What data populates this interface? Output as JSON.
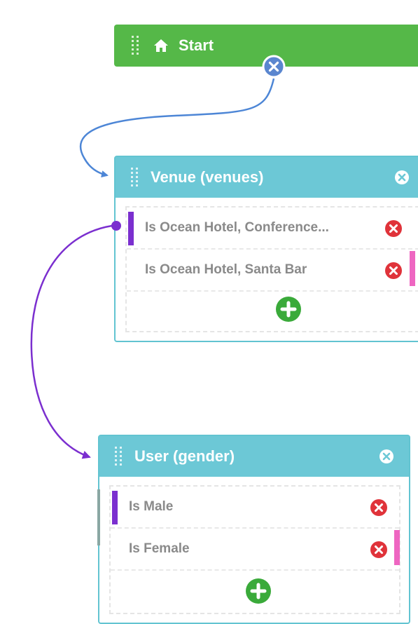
{
  "start": {
    "title": "Start"
  },
  "groups": [
    {
      "title": "Venue (venues)",
      "rules": [
        {
          "label": "Is Ocean Hotel, Conference..."
        },
        {
          "label": "Is Ocean Hotel, Santa Bar"
        }
      ]
    },
    {
      "title": "User (gender)",
      "rules": [
        {
          "label": "Is Male"
        },
        {
          "label": "Is Female"
        }
      ]
    }
  ],
  "colors": {
    "start_green": "#55b848",
    "header_teal": "#6cc8d6",
    "border_teal": "#62c4d1",
    "remove_red": "#e0333a",
    "add_green": "#3aaa3a",
    "connector_blue": "#4d86d6",
    "connector_purple": "#7b2fcf",
    "bar_pink": "#ee66c1",
    "port_blue": "#5a86cf"
  },
  "icons": {
    "drag": "drag-handle-icon",
    "home": "home-icon",
    "remove": "remove-circle-icon",
    "add": "add-circle-icon"
  }
}
